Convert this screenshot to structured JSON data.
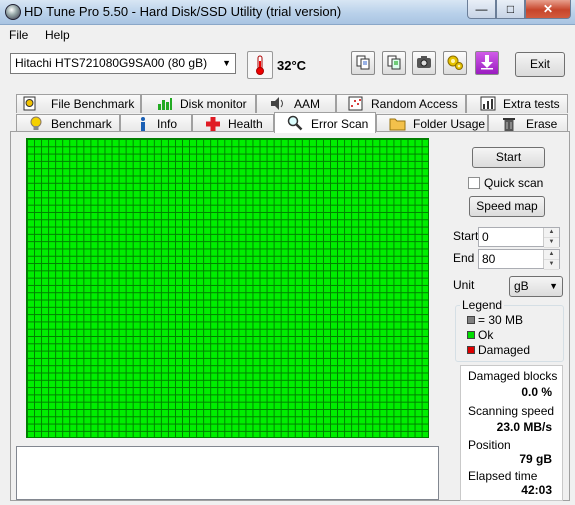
{
  "window": {
    "title": "HD Tune Pro 5.50 - Hard Disk/SSD Utility (trial version)",
    "min_glyph": "—",
    "max_glyph": "□",
    "close_glyph": "✕"
  },
  "menu": [
    "File",
    "Help"
  ],
  "toolbar": {
    "drive": "Hitachi HTS721080G9SA00 (80 gB)",
    "temperature": "32°C",
    "exit_label": "Exit"
  },
  "tabs_top": [
    {
      "label": "File Benchmark",
      "icon": "file-benchmark-icon"
    },
    {
      "label": "Disk monitor",
      "icon": "disk-monitor-icon"
    },
    {
      "label": "AAM",
      "icon": "speaker-icon"
    },
    {
      "label": "Random Access",
      "icon": "random-access-icon"
    },
    {
      "label": "Extra tests",
      "icon": "extra-tests-icon"
    }
  ],
  "tabs_bottom": [
    {
      "label": "Benchmark",
      "icon": "lightbulb-icon"
    },
    {
      "label": "Info",
      "icon": "info-icon"
    },
    {
      "label": "Health",
      "icon": "red-cross-icon"
    },
    {
      "label": "Error Scan",
      "icon": "magnifier-icon",
      "active": true
    },
    {
      "label": "Folder Usage",
      "icon": "folder-icon"
    },
    {
      "label": "Erase",
      "icon": "trash-icon"
    }
  ],
  "scan": {
    "start_button": "Start",
    "quick_scan_label": "Quick scan",
    "quick_scan_checked": false,
    "speed_map_button": "Speed map",
    "start_label": "Start",
    "start_value": "0",
    "end_label": "End",
    "end_value": "80",
    "unit_label": "Unit",
    "unit_value": "gB",
    "legend": {
      "title": "Legend",
      "items": [
        {
          "label": "= 30 MB",
          "color": "#808080"
        },
        {
          "label": "Ok",
          "color": "#00dd00"
        },
        {
          "label": "Damaged",
          "color": "#dd0000"
        }
      ]
    },
    "grid_color_ok": "#00ee00",
    "stats": {
      "damaged_blocks_label": "Damaged blocks",
      "damaged_blocks_value": "0.0 %",
      "scanning_speed_label": "Scanning speed",
      "scanning_speed_value": "23.0 MB/s",
      "position_label": "Position",
      "position_value": "79 gB",
      "elapsed_label": "Elapsed time",
      "elapsed_value": "42:03"
    }
  }
}
